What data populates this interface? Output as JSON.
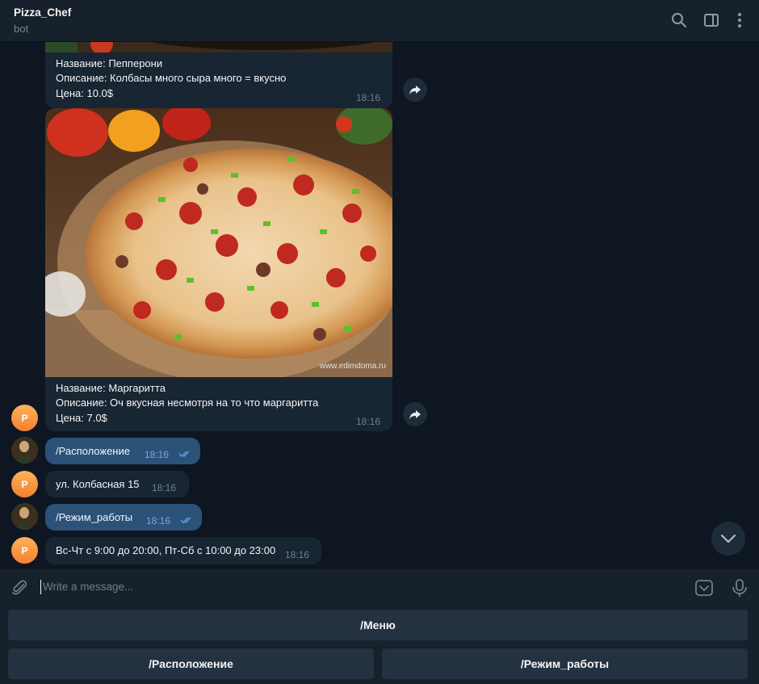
{
  "header": {
    "title": "Pizza_Chef",
    "subtitle": "bot",
    "icons": [
      "search-icon",
      "sidebar-toggle-icon",
      "more-vertical-icon"
    ]
  },
  "messages": {
    "pepperoni": {
      "name": "Название: Пепперони",
      "desc": "Описание: Колбасы много сыра много = вкусно",
      "price": "Цена: 10.0$",
      "time": "18:16"
    },
    "margarita": {
      "name": "Название: Маргаритта",
      "desc": "Описание: Оч вкусная несмотря на то что маргаритта",
      "price": "Цена: 7.0$",
      "time": "18:16",
      "watermark": "www.edimdoma.ru"
    },
    "cmd_location": {
      "text": "/Расположение",
      "time": "18:16"
    },
    "reply_location": {
      "text": "ул. Колбасная 15",
      "time": "18:16"
    },
    "cmd_hours": {
      "text": "/Режим_работы",
      "time": "18:16"
    },
    "reply_hours": {
      "text": "Вс-Чт с 9:00 до 20:00, Пт-Сб с 10:00 до 23:00",
      "time": "18:16"
    }
  },
  "bot_avatar_letter": "P",
  "input": {
    "placeholder": "Write a message..."
  },
  "keyboard": {
    "menu": "/Меню",
    "location": "/Расположение",
    "hours": "/Режим_работы"
  },
  "colors": {
    "background": "#0e1621",
    "panel": "#17212b",
    "incoming_bubble": "#182533",
    "outgoing_bubble": "#2b5278",
    "keyboard_button": "#243140",
    "accent": "#5ea0e6"
  }
}
